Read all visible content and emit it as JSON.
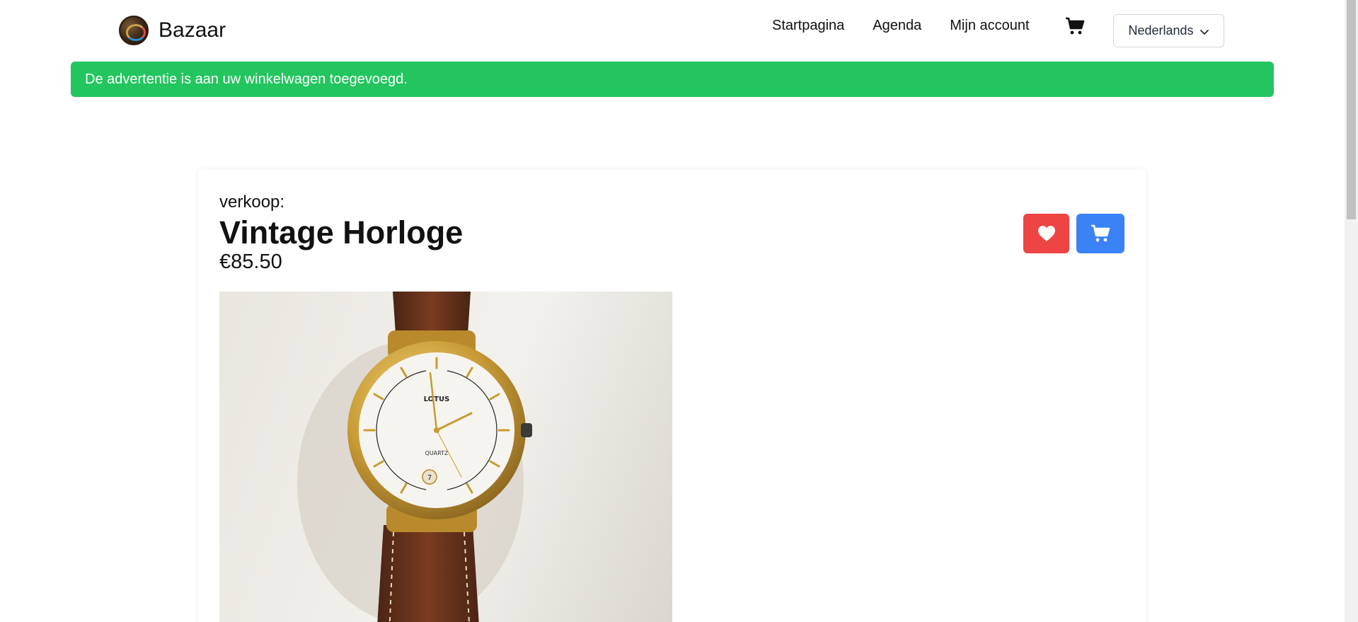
{
  "brand": {
    "name": "Bazaar",
    "logo_icon": "bazaar-logo-icon"
  },
  "nav": {
    "links": [
      {
        "label": "Startpagina"
      },
      {
        "label": "Agenda"
      },
      {
        "label": "Mijn account"
      }
    ],
    "cart_icon": "shopping-cart-icon",
    "language": {
      "selected": "Nederlands",
      "icon": "chevron-down-icon"
    }
  },
  "alert": {
    "message": "De advertentie is aan uw winkelwagen toegevoegd.",
    "color": "#22c55e"
  },
  "listing": {
    "type_label": "verkoop:",
    "title": "Vintage Horloge",
    "price": "€85.50",
    "favorite_icon": "heart-icon",
    "favorite_color": "#ef4444",
    "add_to_cart_icon": "shopping-cart-icon",
    "add_to_cart_color": "#3b82f6",
    "image": {
      "dial_brand": "LOTUS",
      "dial_text": "QUARTZ",
      "date_window": "7"
    }
  }
}
